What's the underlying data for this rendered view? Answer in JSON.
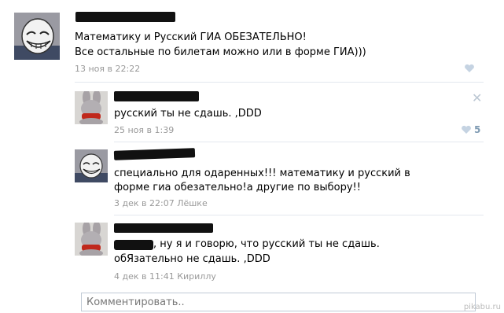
{
  "post": {
    "line1": "Математику и Русский ГИА ОБЕЗАТЕЛЬНО!",
    "line2": "Все остальные по билетам можно или в форме ГИА)))",
    "date": "13 ноя в 22:22"
  },
  "comments": [
    {
      "text": "русский ты не сдашь. ,DDD",
      "date": "25 ноя в 1:39",
      "likes": "5"
    },
    {
      "line1": "специально для одаренных!!! математику и русский в",
      "line2": "форме гиа обезательно!а другие по выбору!!",
      "date": "3 дек в 22:07",
      "reply_to": "Лёшке"
    },
    {
      "line1": ", ну я и говорю, что русский ты не сдашь.",
      "line2": "обЯзательно не сдашь. ,DDD",
      "date": "4 дек в 11:41",
      "reply_to": "Кириллу"
    }
  ],
  "comment_input": {
    "placeholder": "Комментировать.."
  },
  "watermark": "pikabu.ru",
  "icons": [
    "troll-face-avatar",
    "bunny-avatar",
    "heart-icon",
    "close-icon"
  ],
  "colors": {
    "meta": "#999999",
    "separator": "#e3e8ee",
    "like": "#c5d3e2"
  }
}
